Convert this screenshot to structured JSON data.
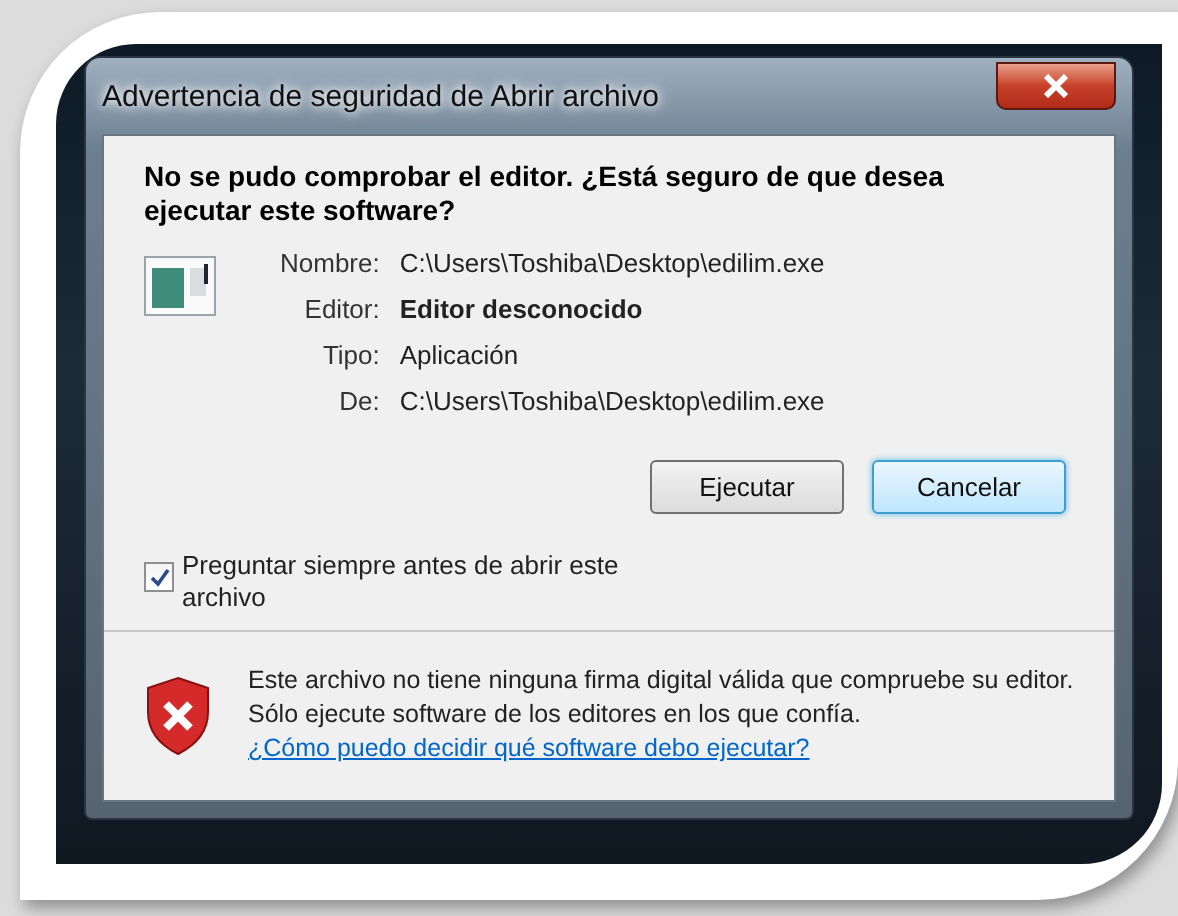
{
  "window": {
    "title": "Advertencia de seguridad de Abrir archivo"
  },
  "heading": "No se pudo comprobar el editor. ¿Está seguro de que desea ejecutar este software?",
  "fields": [
    {
      "label": "Nombre:",
      "value": "C:\\Users\\Toshiba\\Desktop\\edilim.exe",
      "emphasized": false
    },
    {
      "label": "Editor:",
      "value": "Editor desconocido",
      "emphasized": true
    },
    {
      "label": "Tipo:",
      "value": "Aplicación",
      "emphasized": false
    },
    {
      "label": "De:",
      "value": "C:\\Users\\Toshiba\\Desktop\\edilim.exe",
      "emphasized": false
    }
  ],
  "buttons": [
    {
      "label": "Ejecutar",
      "focused": false
    },
    {
      "label": "Cancelar",
      "focused": true
    }
  ],
  "checkbox": {
    "label": "Preguntar siempre antes de abrir este archivo",
    "checked": true
  },
  "footer": {
    "text": "Este archivo no tiene ninguna firma digital válida que compruebe su editor. Sólo ejecute software de los editores en los que confía.",
    "link": "¿Cómo puedo decidir qué software debo ejecutar?"
  }
}
